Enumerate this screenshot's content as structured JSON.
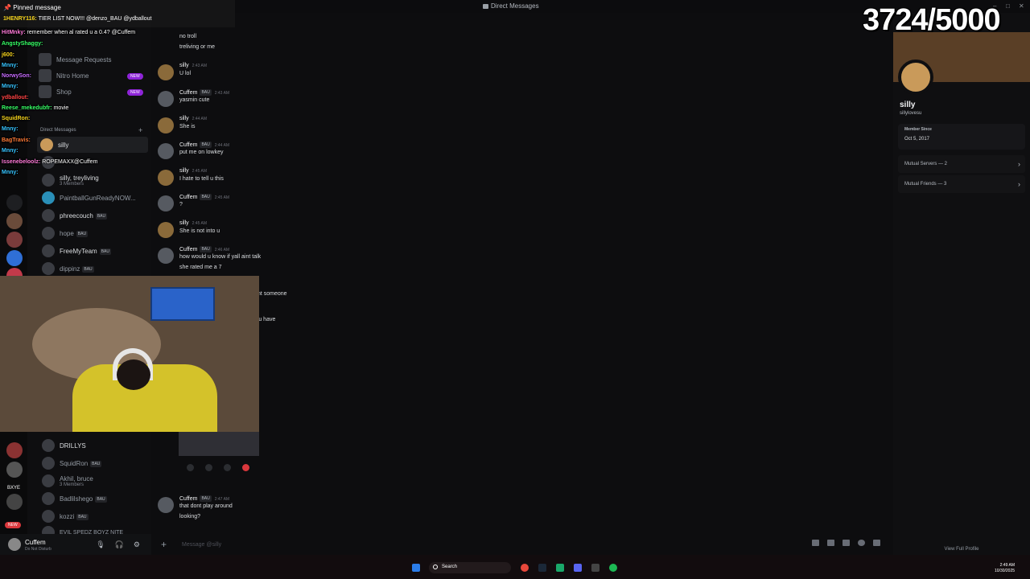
{
  "window": {
    "title": "Direct Messages"
  },
  "stream_overlay": {
    "counter": "3724/5000",
    "pinned_label": "Pinned message",
    "pinned_user": "1HENRY116:",
    "pinned_text": "TIER LIST NOW!!! @denzo_BAU @ydballout",
    "chat": [
      {
        "user": "HitMnky:",
        "text": "remember when al rated u a 0.4? @Cuffem",
        "color": "#ff7ad9"
      },
      {
        "user": "AngstyShaggy:",
        "text": "",
        "color": "#36ff66"
      },
      {
        "user": "j600:",
        "text": "",
        "color": "#f7d51d"
      },
      {
        "user": "Mnny:",
        "text": "",
        "color": "#36c4ff"
      },
      {
        "user": "NorwySon:",
        "text": "",
        "color": "#c86bff"
      },
      {
        "user": "Mnny:",
        "text": "",
        "color": "#36c4ff"
      },
      {
        "user": "ydballout:",
        "text": "",
        "color": "#ff4444"
      },
      {
        "user": "Reese_mekedubfr:",
        "text": "movie",
        "color": "#36ff66"
      },
      {
        "user": "SquidRon:",
        "text": "",
        "color": "#f7d51d"
      },
      {
        "user": "Mnny:",
        "text": "",
        "color": "#36c4ff"
      },
      {
        "user": "BagTravis:",
        "text": "",
        "color": "#ff7a36"
      },
      {
        "user": "Mnny:",
        "text": "",
        "color": "#36c4ff"
      },
      {
        "user": "Issenebeloolz:",
        "text": "ROPEMAXX@Cuffem",
        "color": "#ff7ad9"
      },
      {
        "user": "Mnny:",
        "text": "",
        "color": "#36c4ff"
      }
    ]
  },
  "sidebar": {
    "items": [
      {
        "label": "Message Requests"
      },
      {
        "label": "Nitro Home",
        "badge": "NEW"
      },
      {
        "label": "Shop",
        "badge": "NEW"
      }
    ],
    "section": "Direct Messages",
    "dms": [
      {
        "name": "silly",
        "sub": ""
      },
      {
        "name": "",
        "sub": ""
      },
      {
        "name": "silly, treyliving",
        "sub": "3 Members"
      },
      {
        "name": "PaintballGunReadyNOW...",
        "sub": ""
      },
      {
        "name": "phreecouch",
        "sub": "",
        "bau": "BAU"
      },
      {
        "name": "hope",
        "sub": "",
        "bau": "BAU"
      },
      {
        "name": "FreeMyTeam",
        "sub": "",
        "bau": "BAU"
      },
      {
        "name": "dippinz",
        "sub": "",
        "bau": "BAU"
      }
    ],
    "dms_lower": [
      {
        "name": "DRILLYS",
        "sub": ""
      },
      {
        "name": "SquidRon",
        "sub": "",
        "bau": "BAU"
      },
      {
        "name": "Akhil, bruce",
        "sub": "3 Members"
      },
      {
        "name": "Badlilshego",
        "sub": "",
        "bau": "BAU"
      },
      {
        "name": "kozzi",
        "sub": "",
        "bau": "BAU"
      },
      {
        "name": "EVIL SPEDZ BOYZ NITE",
        "sub": ""
      }
    ],
    "guild_labels": {
      "new": "NEW",
      "bxye": "BXYE"
    }
  },
  "user": {
    "name": "Cuffem",
    "status": "Do Not Disturb"
  },
  "chat": {
    "messages": [
      {
        "author": "",
        "time": "",
        "lines": [
          "no troll",
          "treliving or me"
        ]
      },
      {
        "author": "silly",
        "time": "2:43 AM",
        "lines": [
          "U lol"
        ]
      },
      {
        "author": "Cuffem",
        "bau": "BAU",
        "time": "2:43 AM",
        "lines": [
          "yasmin cute"
        ]
      },
      {
        "author": "silly",
        "time": "2:44 AM",
        "lines": [
          "She is"
        ]
      },
      {
        "author": "Cuffem",
        "bau": "BAU",
        "time": "2:44 AM",
        "lines": [
          "put me on lowkey"
        ]
      },
      {
        "author": "silly",
        "time": "2:45 AM",
        "lines": [
          "I hate to tell u this"
        ]
      },
      {
        "author": "Cuffem",
        "bau": "BAU",
        "time": "2:45 AM",
        "lines": [
          "?"
        ]
      },
      {
        "author": "silly",
        "time": "2:45 AM",
        "lines": [
          "She is not into u"
        ]
      },
      {
        "author": "Cuffem",
        "bau": "BAU",
        "time": "2:46 AM",
        "lines": [
          "how would u know if yall aint talk",
          "she rated me a 7"
        ]
      },
      {
        "author": "Cuffem",
        "bau": "BAU",
        "time": "2:47 AM",
        "lines": [
          "that dont play around",
          "looking?"
        ]
      }
    ],
    "fragments": [
      "want someone",
      "ds u have"
    ],
    "composer_placeholder": "Message @silly"
  },
  "profile": {
    "display_name": "silly",
    "username": "sillylovesu",
    "member_since_label": "Member Since",
    "member_since": "Oct 5, 2017",
    "mutual_servers": "Mutual Servers — 2",
    "mutual_friends": "Mutual Friends — 3",
    "view_full": "View Full Profile"
  },
  "taskbar": {
    "search": "Search",
    "time": "2:49 AM",
    "date": "10/30/2025"
  }
}
